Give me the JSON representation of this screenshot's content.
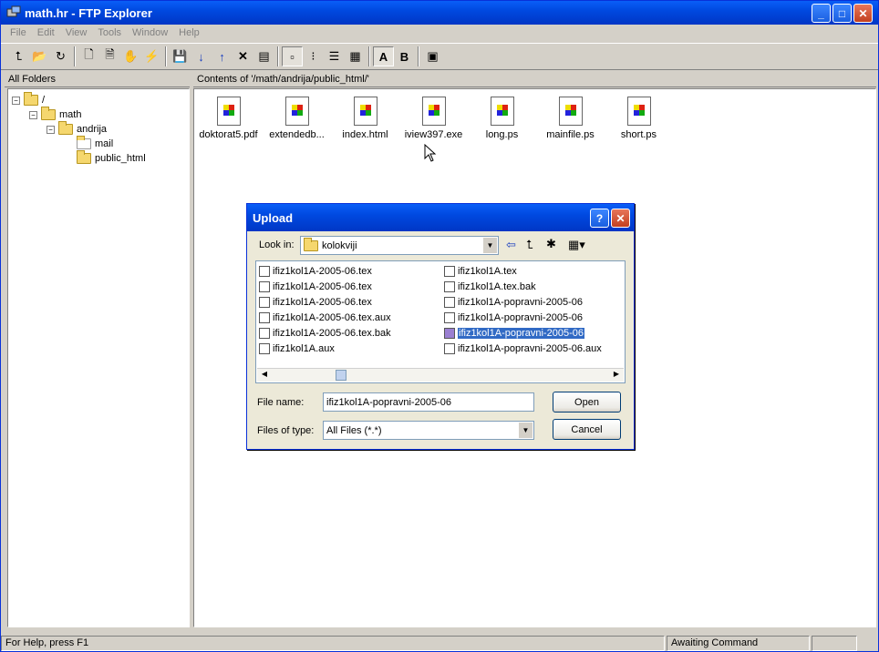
{
  "window": {
    "title": "math.hr - FTP Explorer"
  },
  "menu": [
    "File",
    "Edit",
    "View",
    "Tools",
    "Window",
    "Help"
  ],
  "left_header": "All Folders",
  "right_header": "Contents of '/math/andrija/public_html/'",
  "tree": [
    {
      "label": "/",
      "expander": "−"
    },
    {
      "label": "math",
      "expander": "−"
    },
    {
      "label": "andrija",
      "expander": "−"
    },
    {
      "label": "mail"
    },
    {
      "label": "public_html"
    }
  ],
  "files": [
    "doktorat5.pdf",
    "extendedb...",
    "index.html",
    "iview397.exe",
    "long.ps",
    "mainfile.ps",
    "short.ps"
  ],
  "toolbar": {
    "btn_a": "A",
    "btn_b": "B"
  },
  "status": {
    "help": "For Help, press F1",
    "state": "Awaiting Command"
  },
  "dialog": {
    "title": "Upload",
    "look_in_label": "Look in:",
    "look_in_value": "kolokviji",
    "left_files": [
      "ifiz1kol1A-2005-06.tex",
      "ifiz1kol1A-2005-06.tex",
      "ifiz1kol1A-2005-06.tex",
      "ifiz1kol1A-2005-06.tex.aux",
      "ifiz1kol1A-2005-06.tex.bak",
      "ifiz1kol1A.aux"
    ],
    "right_files": [
      "ifiz1kol1A.tex",
      "ifiz1kol1A.tex.bak",
      "ifiz1kol1A-popravni-2005-06",
      "ifiz1kol1A-popravni-2005-06",
      "ifiz1kol1A-popravni-2005-06",
      "ifiz1kol1A-popravni-2005-06.aux"
    ],
    "file_name_label": "File name:",
    "file_name_value": "ifiz1kol1A-popravni-2005-06",
    "file_type_label": "Files of type:",
    "file_type_value": "All Files (*.*)",
    "open_label": "Open",
    "cancel_label": "Cancel",
    "help_glyph": "?",
    "close_glyph": "✕"
  }
}
